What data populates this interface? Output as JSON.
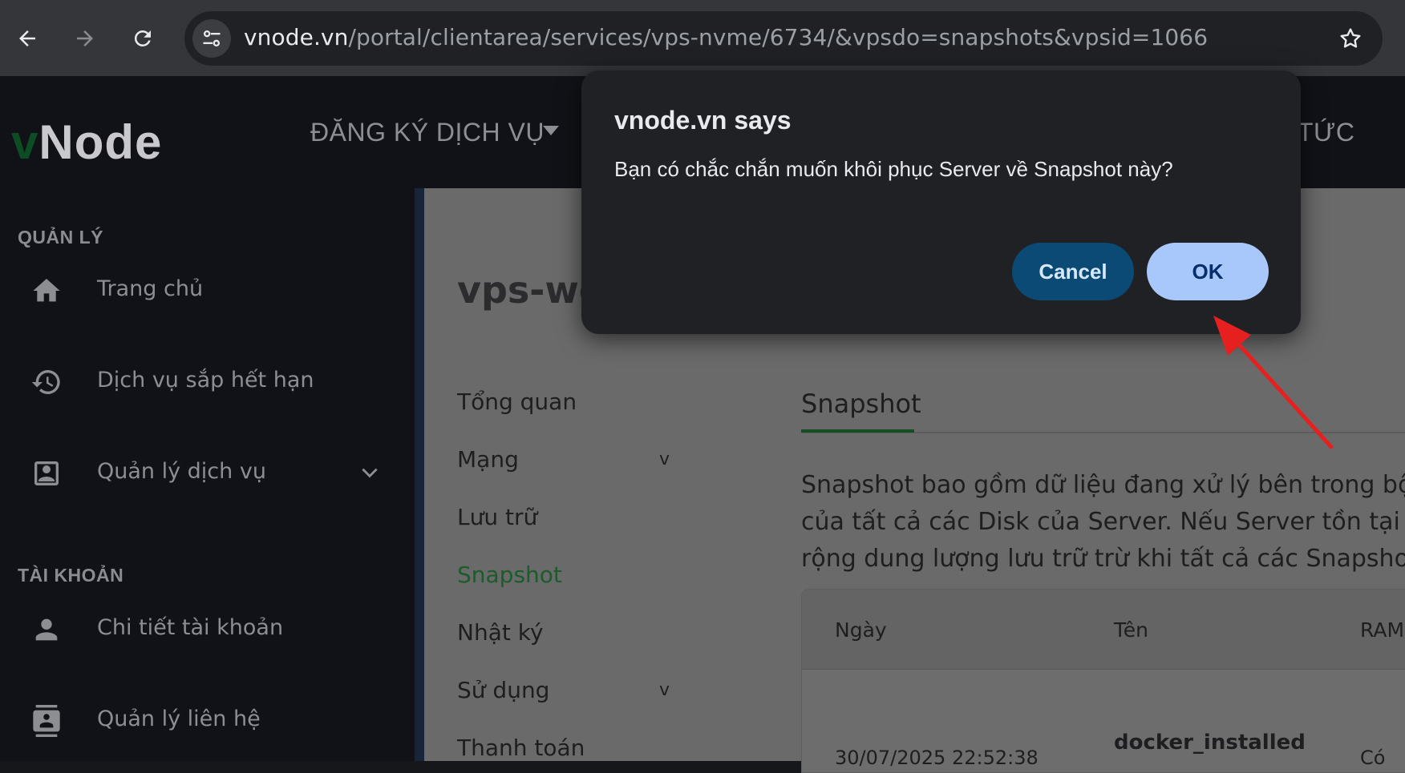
{
  "browser": {
    "url_host": "vnode.vn",
    "url_path": "/portal/clientarea/services/vps-nvme/6734/&vpsdo=snapshots&vpsid=1066",
    "icons": [
      "back-arrow-icon",
      "forward-arrow-icon",
      "reload-icon",
      "site-settings-icon",
      "bookmark-star-icon"
    ]
  },
  "header": {
    "logo_v": "v",
    "logo_rest": "Node",
    "nav": [
      {
        "label": "ĐĂNG KÝ DỊCH VỤ"
      },
      {
        "label": "TỨC"
      }
    ]
  },
  "sidebar": {
    "section_manage": "QUẢN LÝ",
    "section_account": "TÀI KHOẢN",
    "items": [
      {
        "label": "Trang chủ",
        "icon": "home-icon"
      },
      {
        "label": "Dịch vụ sắp hết hạn",
        "icon": "history-icon"
      },
      {
        "label": "Quản lý dịch vụ",
        "icon": "account-box-icon"
      },
      {
        "label": "Chi tiết tài khoản",
        "icon": "person-icon"
      },
      {
        "label": "Quản lý liên hệ",
        "icon": "contacts-icon"
      }
    ]
  },
  "main": {
    "title": "vps-we",
    "subnav": [
      {
        "label": "Tổng quan"
      },
      {
        "label": "Mạng",
        "caret": "v"
      },
      {
        "label": "Lưu trữ"
      },
      {
        "label": "Snapshot"
      },
      {
        "label": "Nhật ký"
      },
      {
        "label": "Sử dụng",
        "caret": "v"
      },
      {
        "label": "Thanh toán"
      }
    ],
    "tab": "Snapshot",
    "description_lines": [
      "Snapshot bao gồm dữ liệu đang xử lý bên trong bộ",
      "của tất cả các Disk của Server. Nếu Server tồn tại",
      "rộng dung lượng lưu trữ trừ khi tất cả các Snapsho"
    ],
    "table": {
      "headers": [
        "Ngày",
        "Tên",
        "RAM"
      ],
      "rows": [
        {
          "date": "30/07/2025 22:52:38",
          "name": "docker_installed",
          "ram": "Có"
        }
      ]
    }
  },
  "dialog": {
    "title": "vnode.vn says",
    "message": "Bạn có chắc chắn muốn khôi phục Server về Snapshot này?",
    "cancel_label": "Cancel",
    "ok_label": "OK"
  },
  "colors": {
    "brand_green": "#0d4d24",
    "active_green": "#1b5c2a",
    "ok_button": "#a8c7fa",
    "cancel_button": "#0b4a74",
    "annotation_arrow": "#e5201f"
  }
}
